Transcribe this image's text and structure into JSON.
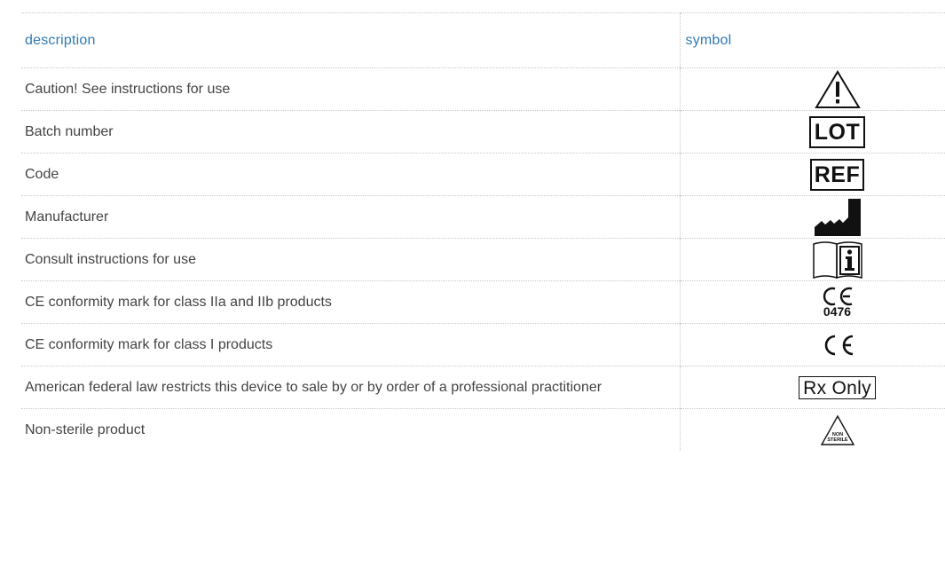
{
  "table": {
    "headers": {
      "description": "description",
      "symbol": "symbol"
    },
    "rows": [
      {
        "description": "Caution! See instructions for use",
        "symbol_icon": "caution-triangle-icon"
      },
      {
        "description": "Batch number",
        "symbol_icon": "lot-icon",
        "symbol_text": "LOT"
      },
      {
        "description": "Code",
        "symbol_icon": "ref-icon",
        "symbol_text": "REF"
      },
      {
        "description": "Manufacturer",
        "symbol_icon": "manufacturer-factory-icon"
      },
      {
        "description": "Consult instructions for use",
        "symbol_icon": "consult-instructions-book-icon"
      },
      {
        "description": "CE conformity mark for class IIa and IIb products",
        "symbol_icon": "ce-mark-icon",
        "symbol_text": "0476"
      },
      {
        "description": "CE conformity mark for class I products",
        "symbol_icon": "ce-mark-icon"
      },
      {
        "description": "American federal law restricts this device to sale by or by order of a professional practitioner",
        "symbol_icon": "rx-only-icon",
        "symbol_text": "Rx Only"
      },
      {
        "description": "Non-sterile product",
        "symbol_icon": "non-sterile-triangle-icon",
        "symbol_text_lines": [
          "NON",
          "STERILE"
        ]
      }
    ]
  },
  "colors": {
    "header_text": "#2f78b5",
    "body_text": "#444444",
    "border": "#c8c8c8",
    "symbol": "#111111"
  }
}
